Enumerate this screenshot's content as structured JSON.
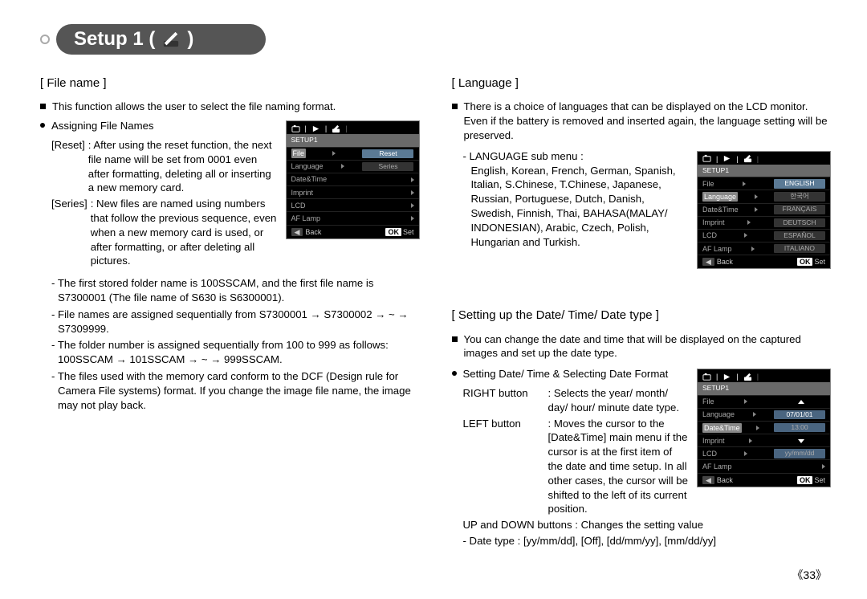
{
  "header": {
    "title_prefix": "Setup 1 (",
    "title_suffix": " )"
  },
  "left": {
    "section_title": "[ File name ]",
    "intro": "This function allows the user to select the file naming format.",
    "sub_bullet": "Assigning File Names",
    "reset_term": "[Reset]",
    "reset_body": ": After using the reset function, the next file name will be set from 0001 even after formatting, deleting all or inserting a new memory card.",
    "series_term": "[Series]",
    "series_body": ": New files are named using numbers that follow the previous sequence, even when a new memory card is used, or after formatting, or after deleting all pictures.",
    "dash1": "- The first stored folder name is 100SSCAM, and the first file name is S7300001 (The file name of S630 is S6300001).",
    "dash2": "- File names are assigned sequentially from S7300001 → S7300002 → ~ → S7309999.",
    "dash3": "- The folder number is assigned sequentially from 100 to 999 as follows: 100SSCAM → 101SSCAM → ~ → 999SSCAM.",
    "dash4": "- The files used with the memory card conform to the DCF (Design rule for Camera File systems) format. If you change the image file name, the image may not play back."
  },
  "right": {
    "lang_title": "[ Language ]",
    "lang_intro": "There is a choice of languages that can be displayed on the LCD monitor. Even if the battery is removed and inserted again, the language setting will be preserved.",
    "lang_sub_label": "- LANGUAGE sub menu :",
    "lang_list": "English, Korean, French, German, Spanish, Italian, S.Chinese, T.Chinese, Japanese, Russian, Portuguese, Dutch, Danish, Swedish, Finnish, Thai, BAHASA(MALAY/ INDONESIAN), Arabic, Czech, Polish, Hungarian and Turkish.",
    "date_title": "[ Setting up the Date/ Time/ Date type ]",
    "date_intro": "You can change the date and time that will be displayed on the captured images and set up the date type.",
    "date_bullet": "Setting Date/ Time & Selecting Date Format",
    "right_btn_label": "RIGHT button",
    "right_btn_body": ": Selects the year/ month/ day/ hour/ minute date type.",
    "left_btn_label": "LEFT button",
    "left_btn_body": ": Moves the cursor to the [Date&Time] main menu if the cursor is at the first item of the date and time setup. In all other cases, the cursor will be shifted to the left of its current position.",
    "updown_line": "UP and DOWN buttons : Changes the setting value",
    "datetype_line": "- Date type : [yy/mm/dd], [Off], [dd/mm/yy], [mm/dd/yy]"
  },
  "lcd1": {
    "header": "SETUP1",
    "rows": [
      {
        "label": "File",
        "sub": "Reset"
      },
      {
        "label": "Language",
        "sub": "Series"
      },
      {
        "label": "Date&Time",
        "sub": ""
      },
      {
        "label": "Imprint",
        "sub": ""
      },
      {
        "label": "LCD",
        "sub": ""
      },
      {
        "label": "AF Lamp",
        "sub": ""
      }
    ],
    "foot_back": "Back",
    "foot_set": "Set"
  },
  "lcd2": {
    "header": "SETUP1",
    "rows": [
      {
        "label": "File",
        "sub": "ENGLISH"
      },
      {
        "label": "Language",
        "sub": "한국어"
      },
      {
        "label": "Date&Time",
        "sub": "FRANÇAIS"
      },
      {
        "label": "Imprint",
        "sub": "DEUTSCH"
      },
      {
        "label": "LCD",
        "sub": "ESPAÑOL"
      },
      {
        "label": "AF Lamp",
        "sub": "ITALIANO"
      }
    ],
    "foot_back": "Back",
    "foot_set": "Set"
  },
  "lcd3": {
    "header": "SETUP1",
    "rows": [
      {
        "label": "File"
      },
      {
        "label": "Language"
      },
      {
        "label": "Date&Time"
      },
      {
        "label": "Imprint"
      },
      {
        "label": "LCD"
      },
      {
        "label": "AF Lamp"
      }
    ],
    "date": "07/01/01",
    "time": "13:00",
    "fmt": "yy/mm/dd",
    "foot_back": "Back",
    "foot_set": "Set"
  },
  "page_number": "《33》"
}
